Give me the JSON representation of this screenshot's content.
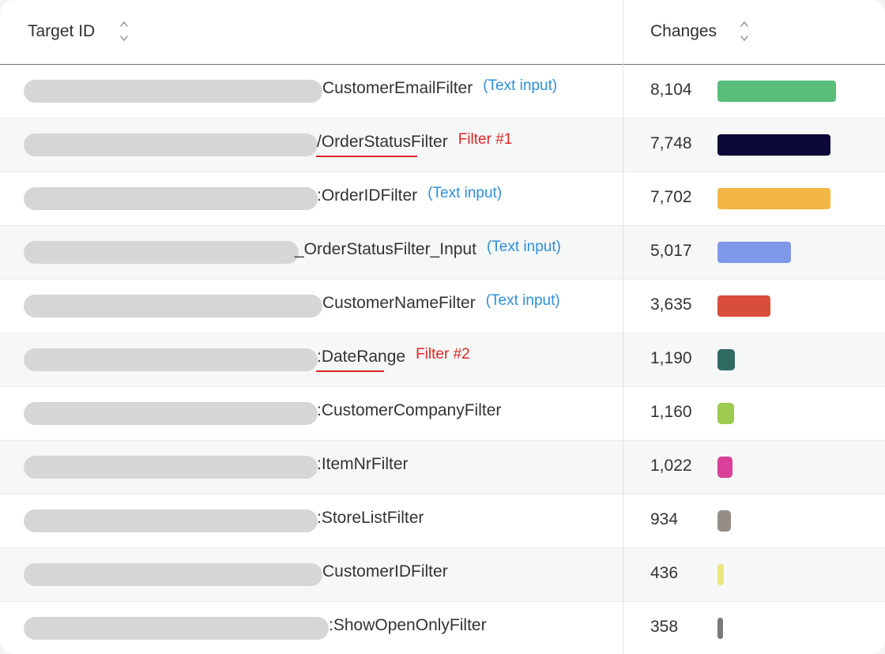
{
  "header": {
    "target_label": "Target ID",
    "changes_label": "Changes"
  },
  "rows": [
    {
      "target": "CustomerEmailFilter",
      "note": "(Text input)",
      "note_type": "blue",
      "count": "8,104",
      "value": 8104,
      "color": "#58be7a"
    },
    {
      "target": "/OrderStatusFilter",
      "note": "Filter #1",
      "note_type": "red",
      "count": "7,748",
      "value": 7748,
      "color": "#0c0838"
    },
    {
      "target": ":OrderIDFilter",
      "note": "(Text input)",
      "note_type": "blue",
      "count": "7,702",
      "value": 7702,
      "color": "#f2b744"
    },
    {
      "target": "_OrderStatusFilter_Input",
      "note": "(Text input)",
      "note_type": "blue",
      "count": "5,017",
      "value": 5017,
      "color": "#7f98e9"
    },
    {
      "target": "CustomerNameFilter",
      "note": "(Text input)",
      "note_type": "blue",
      "count": "3,635",
      "value": 3635,
      "color": "#d94e3b"
    },
    {
      "target": ":DateRange",
      "note": "Filter #2",
      "note_type": "red",
      "count": "1,190",
      "value": 1190,
      "color": "#2f6b63"
    },
    {
      "target": ":CustomerCompanyFilter",
      "note": "",
      "note_type": "",
      "count": "1,160",
      "value": 1160,
      "color": "#9ccb4f"
    },
    {
      "target": ":ItemNrFilter",
      "note": "",
      "note_type": "",
      "count": "1,022",
      "value": 1022,
      "color": "#d8409a"
    },
    {
      "target": ":StoreListFilter",
      "note": "",
      "note_type": "",
      "count": "934",
      "value": 934,
      "color": "#958d87"
    },
    {
      "target": "CustomerIDFilter",
      "note": "",
      "note_type": "",
      "count": "436",
      "value": 436,
      "color": "#ece57a"
    },
    {
      "target": ":ShowOpenOnlyFilter",
      "note": "",
      "note_type": "",
      "count": "358",
      "value": 358,
      "color": "#7a7a7a"
    }
  ]
}
